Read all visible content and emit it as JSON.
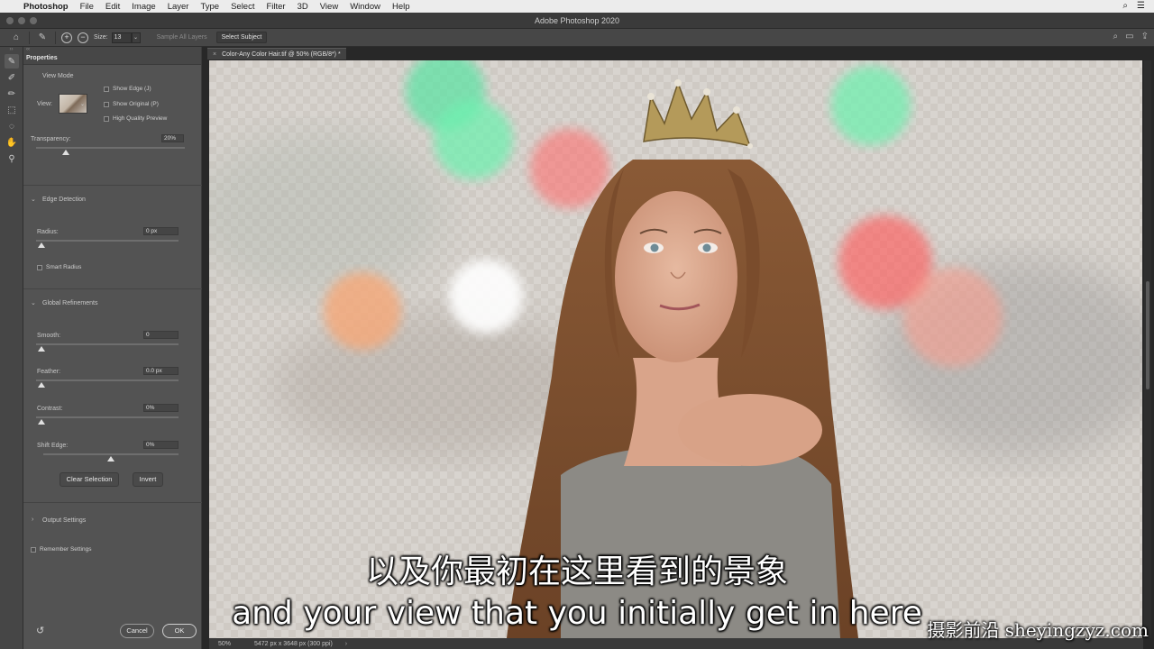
{
  "menubar": {
    "app": "Photoshop",
    "items": [
      "File",
      "Edit",
      "Image",
      "Layer",
      "Type",
      "Select",
      "Filter",
      "3D",
      "View",
      "Window",
      "Help"
    ]
  },
  "window": {
    "title": "Adobe Photoshop 2020"
  },
  "options": {
    "size_label": "Size:",
    "size_value": "13",
    "sample_all_layers": "Sample All Layers",
    "select_subject": "Select Subject"
  },
  "panel": {
    "tab": "Properties",
    "view_mode": {
      "title": "View Mode",
      "view_label": "View:",
      "show_edge": "Show Edge (J)",
      "show_original": "Show Original (P)",
      "high_quality": "High Quality Preview"
    },
    "transparency": {
      "label": "Transparency:",
      "value": "20%",
      "level": 0.2
    },
    "edge_detection": {
      "title": "Edge Detection",
      "radius_label": "Radius:",
      "radius_value": "0 px",
      "smart_radius": "Smart Radius"
    },
    "global_refinements": {
      "title": "Global Refinements",
      "smooth_label": "Smooth:",
      "smooth_value": "0",
      "feather_label": "Feather:",
      "feather_value": "0.0 px",
      "contrast_label": "Contrast:",
      "contrast_value": "0%",
      "shift_edge_label": "Shift Edge:",
      "shift_edge_value": "0%",
      "clear_selection": "Clear Selection",
      "invert": "Invert"
    },
    "output_settings": "Output Settings",
    "remember_settings": "Remember Settings",
    "cancel": "Cancel",
    "ok": "OK"
  },
  "document": {
    "tab_title": "Color-Any Color Hair.tif @ 50% (RGB/8*) *",
    "zoom": "50%",
    "info": "5472 px x 3648 px (300 ppi)"
  },
  "captions": {
    "chinese": "以及你最初在这里看到的景象",
    "english": "and your view that you initially get in here"
  },
  "watermark": "摄影前沿 sheyingzyz.com",
  "icons": {
    "tools": [
      "quick-selection-icon",
      "refine-edge-brush-icon",
      "brush-icon",
      "object-selection-icon",
      "lasso-icon",
      "hand-icon",
      "zoom-icon"
    ]
  },
  "colors": {
    "menubar": "#ececec",
    "panel": "#535353",
    "document_bg": "#282828"
  }
}
